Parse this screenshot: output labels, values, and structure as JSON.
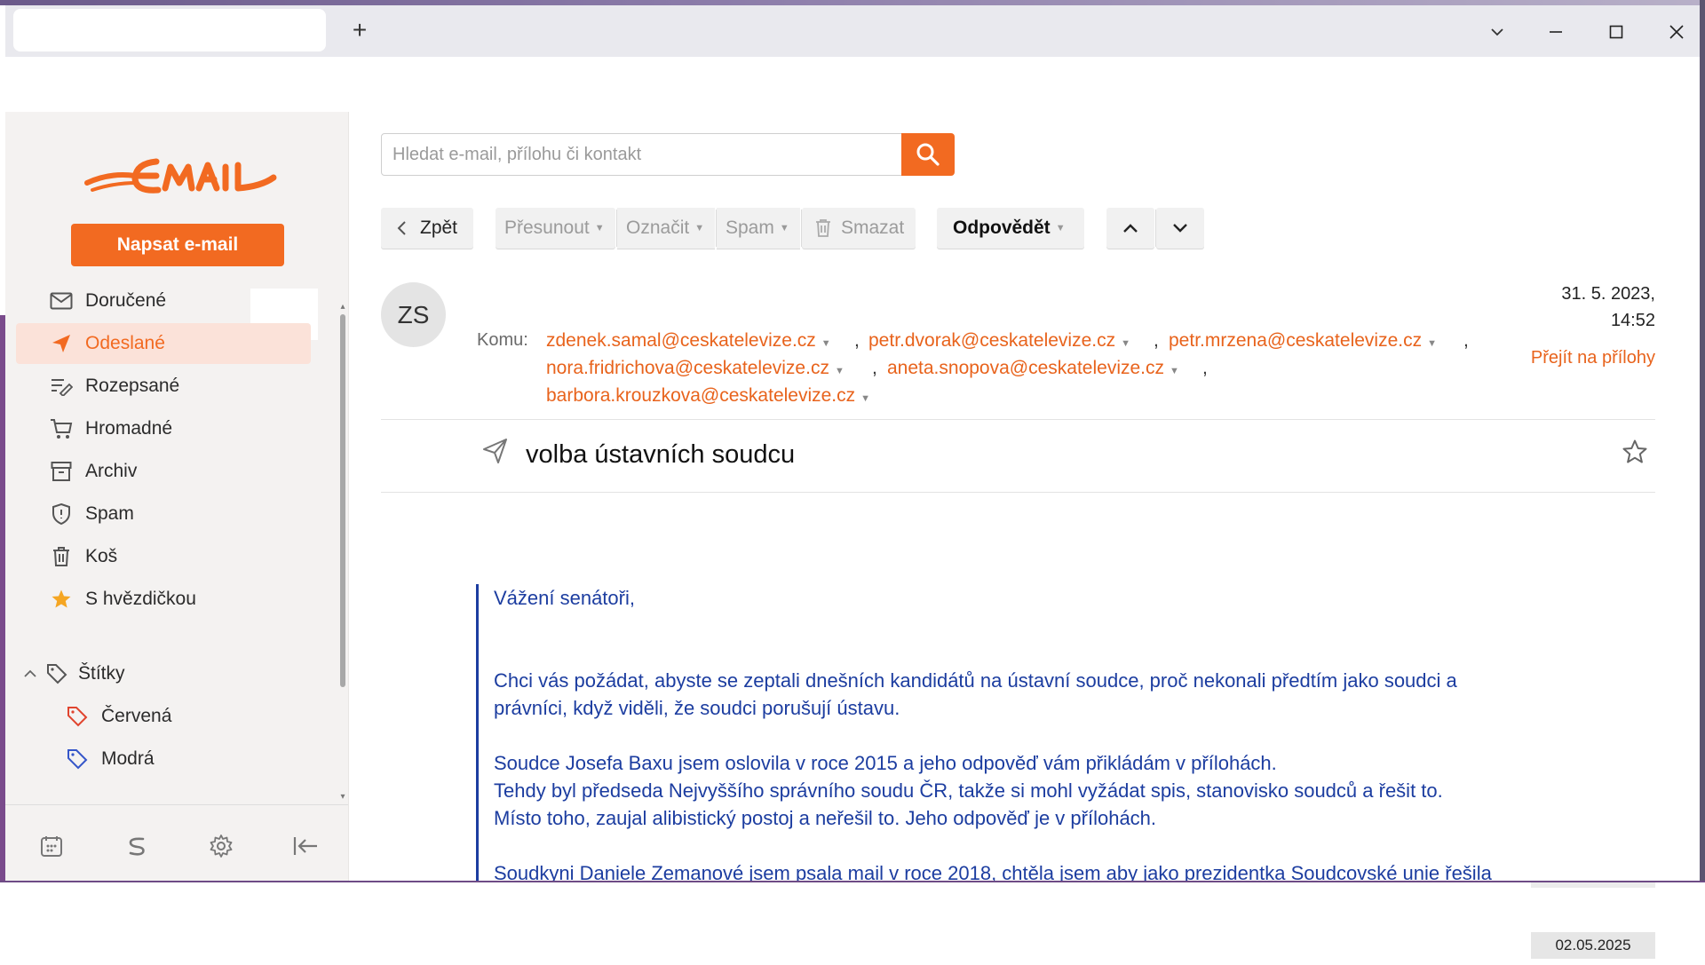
{
  "window": {
    "new_tab": "+",
    "list_tabs": "⌵",
    "minimize": "—",
    "maximize": "☐",
    "close": "✕"
  },
  "sidebar": {
    "logo_text": "EMAIL",
    "compose_label": "Napsat e-mail",
    "items": [
      {
        "label": "Doručené",
        "icon": "inbox-icon"
      },
      {
        "label": "Odeslané",
        "icon": "send-icon",
        "active": true
      },
      {
        "label": "Rozepsané",
        "icon": "draft-icon"
      },
      {
        "label": "Hromadné",
        "icon": "cart-icon"
      },
      {
        "label": "Archiv",
        "icon": "archive-icon"
      },
      {
        "label": "Spam",
        "icon": "shield-icon"
      },
      {
        "label": "Koš",
        "icon": "trash-icon"
      },
      {
        "label": "S hvězdičkou",
        "icon": "star-icon"
      }
    ],
    "labels_section": "Štítky",
    "tags": [
      {
        "label": "Červená",
        "color": "#e0442e"
      },
      {
        "label": "Modrá",
        "color": "#3556c9"
      }
    ],
    "footer_icons": [
      "calendar-icon",
      "s-brand-icon",
      "settings-icon",
      "collapse-icon"
    ]
  },
  "search": {
    "placeholder": "Hledat e-mail, přílohu či kontakt",
    "value": ""
  },
  "toolbar": {
    "back": "Zpět",
    "move": "Přesunout",
    "mark": "Označit",
    "spam": "Spam",
    "delete": "Smazat",
    "reply": "Odpovědět"
  },
  "message": {
    "sender_initials": "ZS",
    "to_label": "Komu:",
    "recipients": [
      "zdenek.samal@ceskatelevize.cz",
      "petr.dvorak@ceskatelevize.cz",
      "petr.mrzena@ceskatelevize.cz",
      "nora.fridrichova@ceskatelevize.cz",
      "aneta.snopova@ceskatelevize.cz",
      "barbora.krouzkova@ceskatelevize.cz"
    ],
    "date_line1": "31. 5. 2023,",
    "date_line2": "14:52",
    "attachments_link": "Přejít na přílohy",
    "subject": "volba ústavních soudcu",
    "body": [
      "Vážení senátoři,",
      "",
      "",
      "Chci vás požádat, abyste se zeptali dnešních kandidátů na ústavní soudce, proč nekonali předtím jako soudci a",
      "právníci, když viděli, že soudci porušují ústavu.",
      "",
      "Soudce Josefa Baxu jsem oslovila v roce 2015 a jeho odpověď vám přikládám v přílohách.",
      "Tehdy byl předseda Nejvyššího správního soudu ČR, takže si mohl vyžádat spis, stanovisko soudců a řešit to.",
      "Místo toho, zaujal alibistický postoj a neřešil to. Jeho odpověď je v přílohách.",
      "",
      "Soudkyni Daniele Zemanové jsem psala mail v roce 2018, chtěla jsem aby jako prezidentka Soudcovské unie řešila"
    ]
  },
  "taskbar": {
    "date": "02.05.2025"
  },
  "colors": {
    "accent": "#f26a21",
    "quote": "#1c3da0",
    "link": "#e8631c"
  }
}
